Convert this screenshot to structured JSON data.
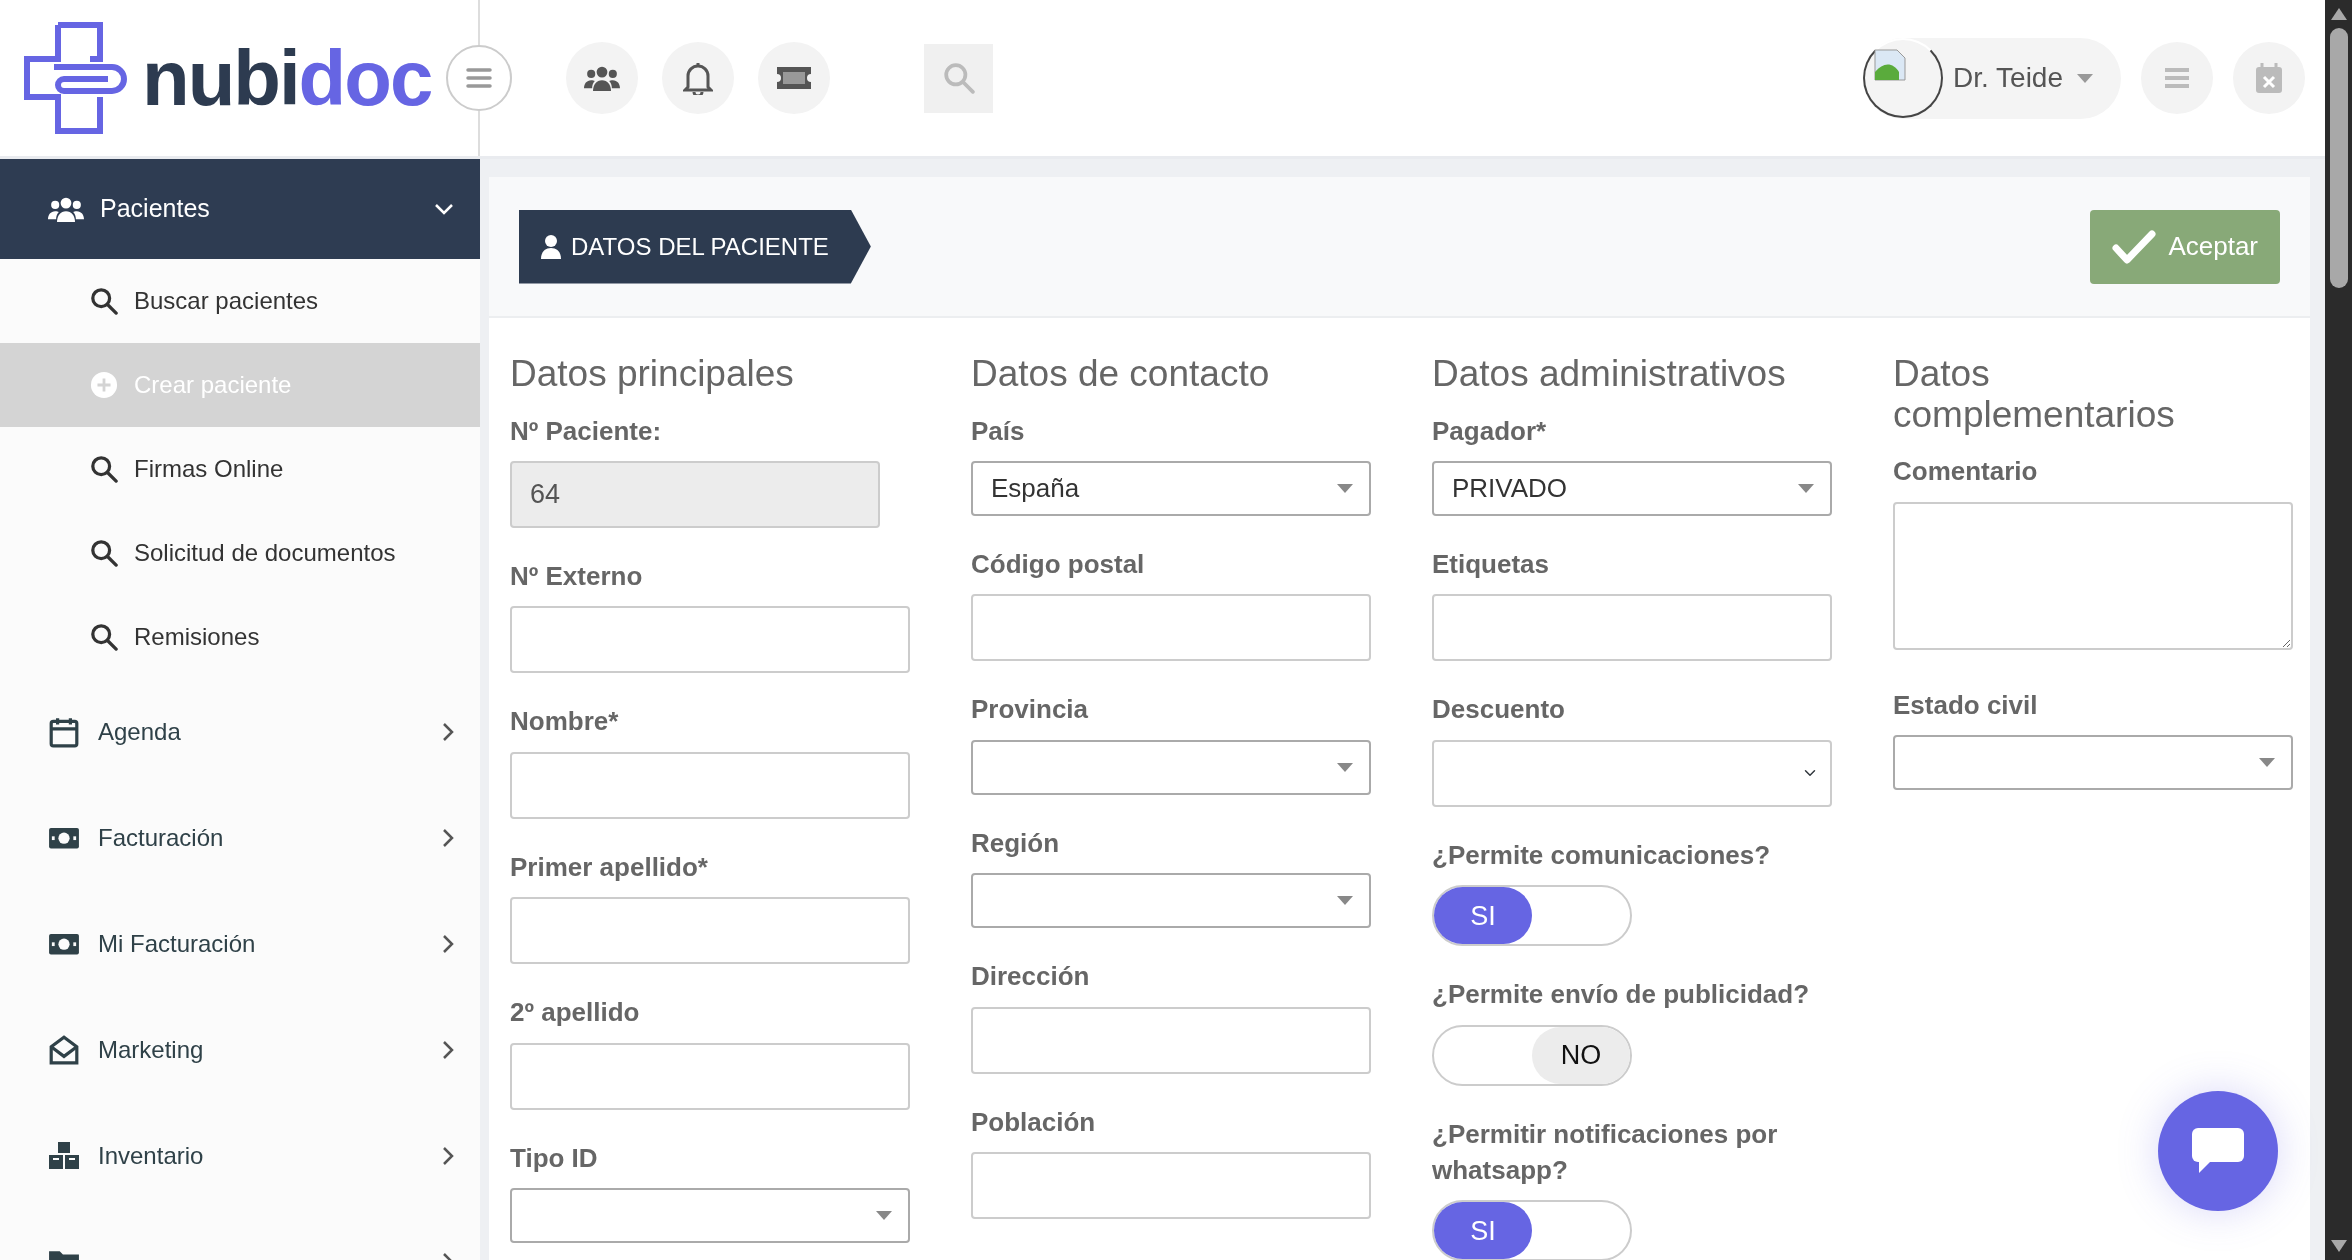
{
  "logo": {
    "text_dark": "nubi",
    "text_accent": "doc"
  },
  "user": {
    "name": "Dr. Teide"
  },
  "sidebar": {
    "items": [
      {
        "label": "Pacientes",
        "kind": "users",
        "expanded": true,
        "children": [
          {
            "label": "Buscar pacientes",
            "kind": "search",
            "selected": false
          },
          {
            "label": "Crear paciente",
            "kind": "plus",
            "selected": true
          },
          {
            "label": "Firmas Online",
            "kind": "search",
            "selected": false
          },
          {
            "label": "Solicitud de documentos",
            "kind": "search",
            "selected": false
          },
          {
            "label": "Remisiones",
            "kind": "search",
            "selected": false
          }
        ]
      },
      {
        "label": "Agenda",
        "kind": "calendar",
        "expanded": false
      },
      {
        "label": "Facturación",
        "kind": "money",
        "expanded": false
      },
      {
        "label": "Mi Facturación",
        "kind": "money",
        "expanded": false
      },
      {
        "label": "Marketing",
        "kind": "mail",
        "expanded": false
      },
      {
        "label": "Inventario",
        "kind": "boxes",
        "expanded": false
      },
      {
        "kind": "folder",
        "expanded": false
      }
    ]
  },
  "page_title": "DATOS DEL PACIENTE",
  "accept_button": "Aceptar",
  "columns": [
    {
      "title": "Datos principales",
      "fields": [
        {
          "kind": "input",
          "label": "Nº Paciente:",
          "value": "64",
          "disabled": true
        },
        {
          "kind": "input",
          "label": "Nº Externo",
          "disabled": false
        },
        {
          "kind": "input",
          "label": "Nombre*",
          "disabled": false
        },
        {
          "kind": "input",
          "label": "Primer apellido*",
          "disabled": false
        },
        {
          "kind": "input",
          "label": "2º apellido",
          "disabled": false
        },
        {
          "kind": "combo",
          "label": "Tipo ID"
        }
      ]
    },
    {
      "title": "Datos de contacto",
      "fields": [
        {
          "kind": "combo",
          "label": "País",
          "value": "España"
        },
        {
          "kind": "input",
          "label": "Código postal",
          "disabled": false
        },
        {
          "kind": "combo",
          "label": "Provincia"
        },
        {
          "kind": "combo",
          "label": "Región"
        },
        {
          "kind": "input",
          "label": "Dirección",
          "disabled": false
        },
        {
          "kind": "input",
          "label": "Población",
          "disabled": false
        }
      ]
    },
    {
      "title": "Datos administrativos",
      "fields": [
        {
          "kind": "combo",
          "label": "Pagador*",
          "value": "PRIVADO"
        },
        {
          "kind": "input",
          "label": "Etiquetas",
          "disabled": false
        },
        {
          "kind": "select",
          "label": "Descuento"
        },
        {
          "kind": "toggle",
          "label": "¿Permite comunicaciones?",
          "on": true,
          "text": "SI"
        },
        {
          "kind": "toggle",
          "label": "¿Permite envío de publicidad?",
          "on": false,
          "text": "NO"
        },
        {
          "kind": "toggle",
          "label": "¿Permitir notificaciones por whatsapp?",
          "on": true,
          "text": "SI"
        }
      ]
    },
    {
      "title": "Datos complementarios",
      "fields": [
        {
          "kind": "textarea",
          "label": "Comentario"
        },
        {
          "kind": "combo",
          "label": "Estado civil"
        }
      ]
    }
  ]
}
